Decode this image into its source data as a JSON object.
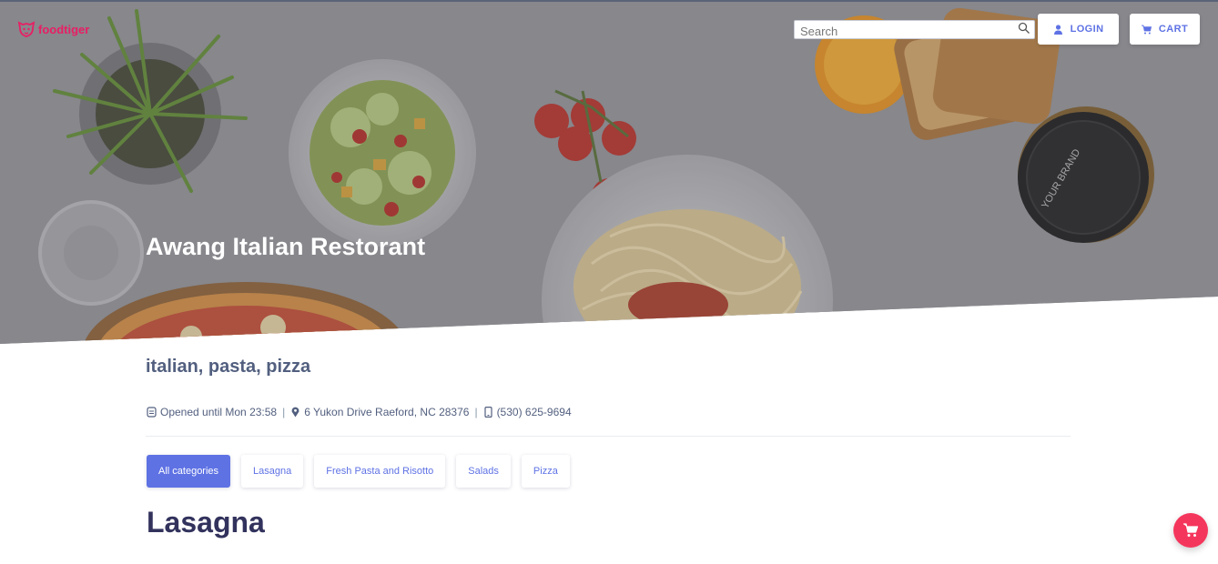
{
  "brand": {
    "name": "foodtiger",
    "color": "#e91e63",
    "icon": "tiger-logo-icon"
  },
  "header": {
    "search": {
      "placeholder": "Search",
      "value": ""
    },
    "login_label": "LOGIN",
    "cart_label": "CART"
  },
  "restaurant": {
    "name": "Awang Italian Restorant",
    "tags": "italian, pasta, pizza",
    "hours": "Opened until Mon 23:58",
    "address": "6 Yukon Drive Raeford, NC 28376",
    "phone": "(530) 625-9694"
  },
  "categories": [
    {
      "label": "All categories",
      "active": true
    },
    {
      "label": "Lasagna",
      "active": false
    },
    {
      "label": "Fresh Pasta and Risotto",
      "active": false
    },
    {
      "label": "Salads",
      "active": false
    },
    {
      "label": "Pizza",
      "active": false
    }
  ],
  "section": {
    "title": "Lasagna"
  },
  "colors": {
    "primary": "#5e72e4",
    "danger": "#f5365c",
    "text": "#525f7f",
    "heading": "#32325d"
  }
}
